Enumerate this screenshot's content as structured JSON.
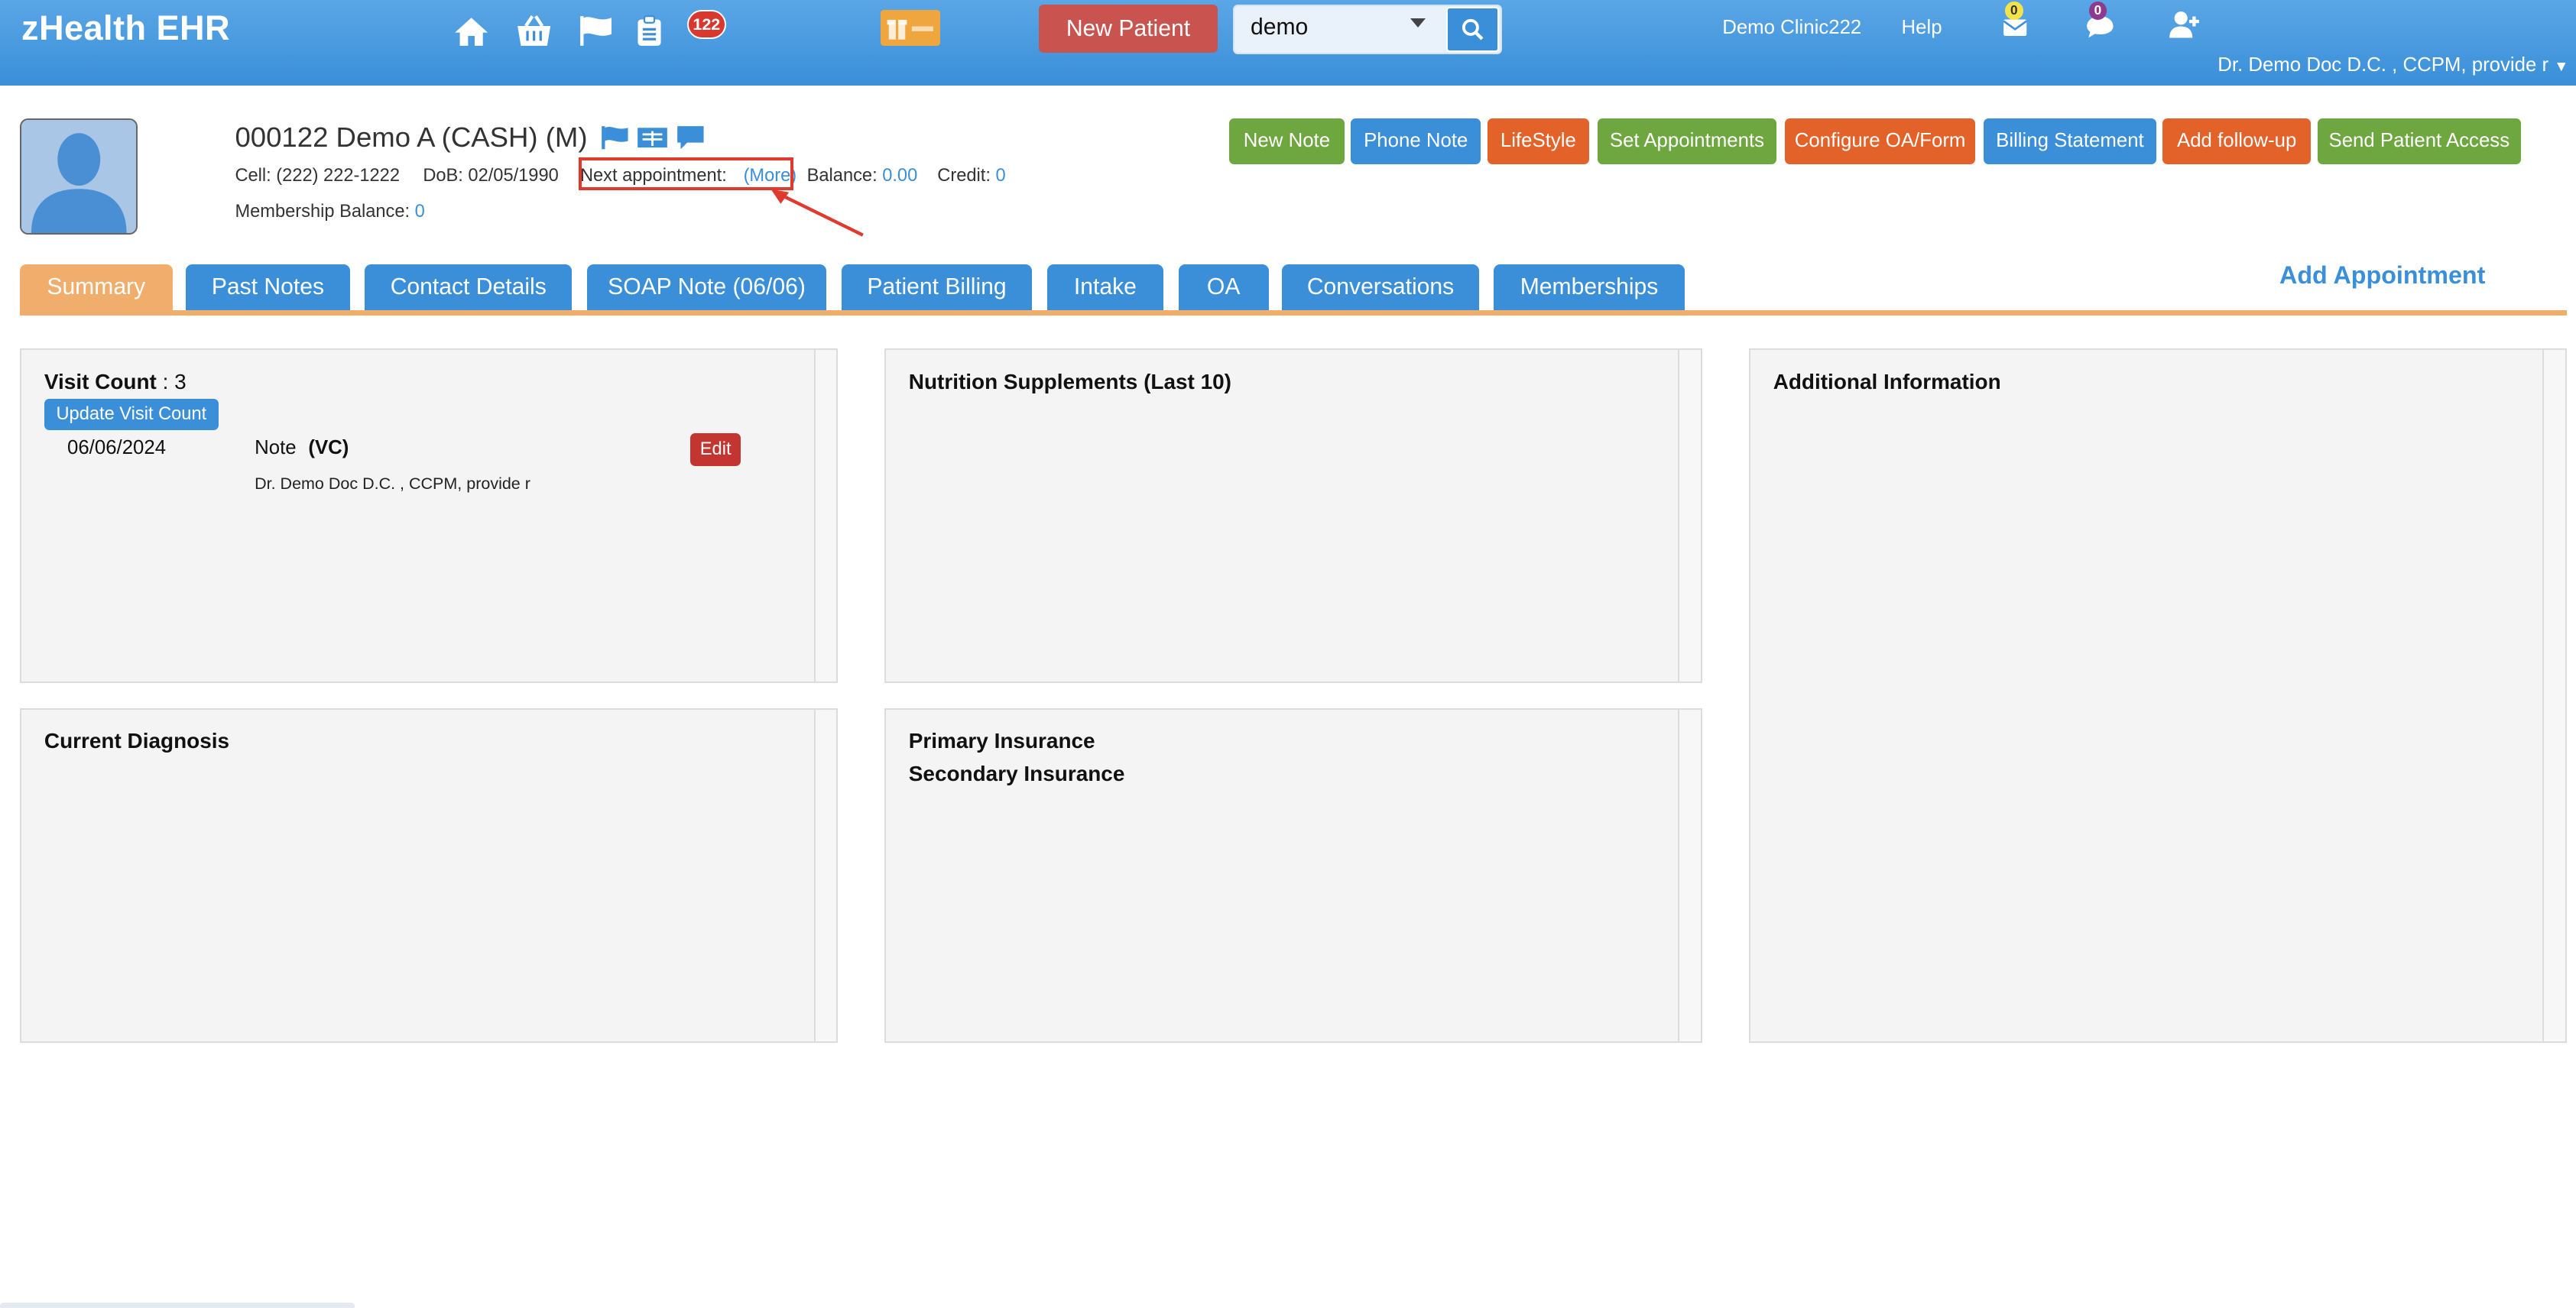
{
  "header": {
    "brand": "zHealth EHR",
    "notification_count": "122",
    "new_patient_label": "New Patient",
    "search": {
      "value": "demo",
      "placeholder": ""
    },
    "clinic": "Demo Clinic222",
    "help": "Help",
    "mail_count": "0",
    "chat_count": "0",
    "user": "Dr. Demo Doc D.C. , CCPM, provide r"
  },
  "patient": {
    "title": "000122 Demo A  (CASH) (M)",
    "cell": "Cell: (222) 222-1222",
    "dob": "DoB: 02/05/1990",
    "next_appointment_label": "Next appointment:",
    "next_appointment_link": "(More)",
    "balance_label": "Balance:",
    "balance_value": "0.00",
    "credit_label": "Credit:",
    "credit_value": "0",
    "membership_label": "Membership Balance:",
    "membership_value": "0"
  },
  "actions": [
    {
      "label": "New Note",
      "color": "#6ea63f"
    },
    {
      "label": "Phone Note",
      "color": "#3a8fd8"
    },
    {
      "label": "LifeStyle",
      "color": "#e2622a"
    },
    {
      "label": "Set Appointments",
      "color": "#6ea63f"
    },
    {
      "label": "Configure OA/Form",
      "color": "#e2622a"
    },
    {
      "label": "Billing Statement",
      "color": "#3a8fd8"
    },
    {
      "label": "Add follow-up",
      "color": "#e2622a"
    },
    {
      "label": "Send Patient Access",
      "color": "#6ea63f"
    }
  ],
  "tabs": [
    {
      "label": "Summary"
    },
    {
      "label": "Past Notes"
    },
    {
      "label": "Contact Details"
    },
    {
      "label": "SOAP Note (06/06)"
    },
    {
      "label": "Patient Billing"
    },
    {
      "label": "Intake"
    },
    {
      "label": "OA"
    },
    {
      "label": "Conversations"
    },
    {
      "label": "Memberships"
    }
  ],
  "add_appointment": "Add Appointment",
  "visits": {
    "count_label": "Visit Count",
    "count_value": " : 3",
    "update_button": "Update Visit Count",
    "date": "06/06/2024",
    "note_label": "Note",
    "note_type": "(VC)",
    "edit_button": "Edit",
    "provider": "Dr. Demo Doc D.C. , CCPM, provide r"
  },
  "panels": {
    "nutrition": "Nutrition Supplements (Last 10)",
    "additional": "Additional Information",
    "diagnosis": "Current Diagnosis",
    "primary_insurance": "Primary Insurance",
    "secondary_insurance": "Secondary Insurance"
  },
  "colors": {
    "primary_blue": "#3a8fd8",
    "tab_active": "#f1ad6c",
    "annotation_red": "#e03a2f"
  }
}
